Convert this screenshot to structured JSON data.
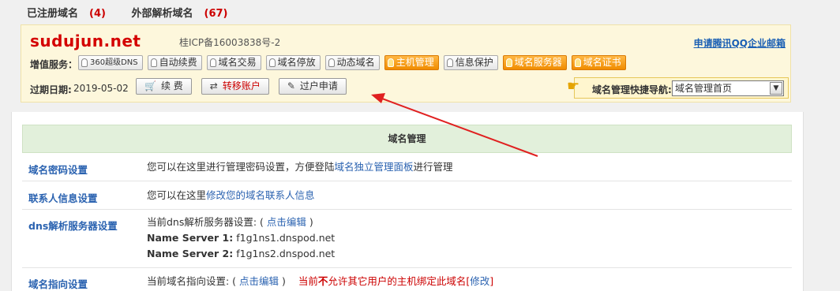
{
  "tabs": {
    "registered_label": "已注册域名",
    "registered_count": "(4)",
    "external_label": "外部解析域名",
    "external_count": "(67)"
  },
  "domain": {
    "name": "sudujun.net",
    "icp": "桂ICP备16003838号-2",
    "qq_mail_link": "申请腾讯QQ企业邮箱",
    "vas_label": "增值服务：",
    "services": [
      {
        "label": "360超级DNS",
        "active": false,
        "small": true
      },
      {
        "label": "自动续费",
        "active": false
      },
      {
        "label": "域名交易",
        "active": false
      },
      {
        "label": "域名停放",
        "active": false
      },
      {
        "label": "动态域名",
        "active": false
      },
      {
        "label": "主机管理",
        "active": true
      },
      {
        "label": "信息保护",
        "active": false
      },
      {
        "label": "域名服务器",
        "active": true
      },
      {
        "label": "域名证书",
        "active": true
      }
    ],
    "expiry_label": "过期日期:",
    "expiry_date": "2019-05-02",
    "actions": {
      "renew": "续 费",
      "transfer_account": "转移账户",
      "transfer_request": "过户申请"
    },
    "quick_nav": {
      "label": "域名管理快捷导航:",
      "selected": "域名管理首页"
    }
  },
  "management": {
    "header": "域名管理",
    "rows": {
      "password": {
        "key": "域名密码设置",
        "text_a": "您可以在这里进行管理密码设置，方便登陆",
        "link": "域名独立管理面板",
        "text_b": "进行管理"
      },
      "contact": {
        "key": "联系人信息设置",
        "text_a": "您可以在这里",
        "link": "修改您的域名联系人信息"
      },
      "dns": {
        "key": "dns解析服务器设置",
        "text_a": "当前dns解析服务器设置: (",
        "link": "点击编辑",
        "text_b": ")",
        "ns1_label": "Name Server 1:",
        "ns1_value": "f1g1ns1.dnspod.net",
        "ns2_label": "Name Server 2:",
        "ns2_value": "f1g1ns2.dnspod.net"
      },
      "pointing": {
        "key": "域名指向设置",
        "text_a": "当前域名指向设置: (",
        "link": "点击编辑",
        "text_b": ")",
        "warn_a": "当前",
        "warn_not": "不",
        "warn_b": "允许其它用户的主机绑定此域名[",
        "warn_link": "修改",
        "warn_c": "]"
      }
    }
  },
  "colors": {
    "brand_red": "#d40000",
    "link_blue": "#2a62b0",
    "active_orange": "#f08c00",
    "header_green": "#e2f0db",
    "annotation_red": "#e02020"
  }
}
